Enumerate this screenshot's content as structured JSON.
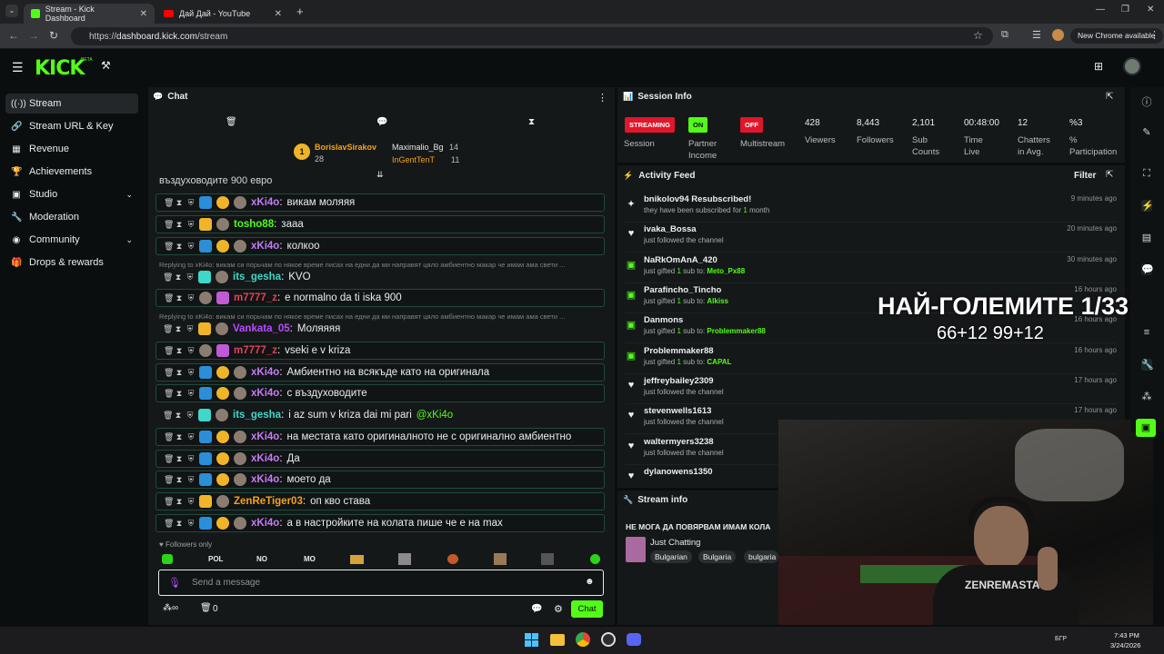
{
  "browser": {
    "tabs": [
      {
        "label": "Stream - Kick Dashboard",
        "active": true
      },
      {
        "label": "Дай Дай - YouTube",
        "active": false
      }
    ],
    "url_prefix": "https://",
    "url_host": "dashboard.kick.com",
    "url_path": "/stream",
    "new_chrome": "New Chrome available"
  },
  "sidebar": {
    "items": [
      {
        "label": "Stream",
        "icon": "broadcast-icon",
        "glyph": "((·))"
      },
      {
        "label": "Stream URL & Key",
        "icon": "link-icon",
        "glyph": "🔗"
      },
      {
        "label": "Revenue",
        "icon": "revenue-icon",
        "glyph": "▦"
      },
      {
        "label": "Achievements",
        "icon": "trophy-icon",
        "glyph": "🏆"
      },
      {
        "label": "Studio",
        "icon": "studio-icon",
        "glyph": "▣"
      },
      {
        "label": "Moderation",
        "icon": "wrench-icon",
        "glyph": "🔧"
      },
      {
        "label": "Community",
        "icon": "globe-icon",
        "glyph": "◉"
      },
      {
        "label": "Drops & rewards",
        "icon": "gift-icon",
        "glyph": "🎁"
      }
    ]
  },
  "chat": {
    "title": "Chat",
    "pinned": [
      {
        "rank": "1",
        "name": "BorislavSirakov",
        "count": "28"
      },
      {
        "name": "Maximalio_Bg",
        "count": "14"
      },
      {
        "name": "InGentTenT",
        "count": "11"
      }
    ],
    "pinned_partial": "въздуховодите 900 евро",
    "messages": [
      {
        "user": "xKi4o",
        "color": "#c57bf5",
        "text": "викам моляяя"
      },
      {
        "user": "tosho88",
        "color": "#53fc18",
        "text": "зааа"
      },
      {
        "user": "xKi4o",
        "color": "#c57bf5",
        "text": "колкоо"
      },
      {
        "reply": "Replying to xKi4o: викам си порьчам по някое време писах на едни да ми направят цяло амбиентно макар че имам ама свети ...",
        "user": "its_gesha",
        "color": "#3fd7c9",
        "text": "KVO"
      },
      {
        "user": "m7777_z",
        "color": "#e0415b",
        "text": "e normalno da ti iska 900"
      },
      {
        "reply": "Replying to xKi4o: викам си порьчам по някое време писах на едни да ми направят цяло амбиентно макар че имам ама свети ...",
        "user": "Vankata_05",
        "color": "#b54cff",
        "text": "Моляяяя"
      },
      {
        "user": "m7777_z",
        "color": "#e0415b",
        "text": "vseki e v kriza"
      },
      {
        "user": "xKi4o",
        "color": "#c57bf5",
        "text": "Амбиентно на всякъде като на оригинала"
      },
      {
        "user": "xKi4o",
        "color": "#c57bf5",
        "text": "с въздуховодите"
      },
      {
        "user": "its_gesha",
        "color": "#3fd7c9",
        "text": "i az sum v kriza dai mi pari",
        "mention": "@xKi4o"
      },
      {
        "user": "xKi4o",
        "color": "#c57bf5",
        "text": "на местата като оригиналното не с оригинално амбиентно"
      },
      {
        "user": "xKi4o",
        "color": "#c57bf5",
        "text": "Да"
      },
      {
        "user": "xKi4o",
        "color": "#c57bf5",
        "text": "моето да"
      },
      {
        "user": "ZenReTiger03",
        "color": "#f4a21a",
        "text": "оп кво става"
      },
      {
        "user": "xKi4o",
        "color": "#c57bf5",
        "text": "а в настройките на колата пише че е на max"
      }
    ],
    "followers_only": "Followers only",
    "emote_labels": [
      "POL",
      "NO",
      "MO"
    ],
    "input_placeholder": "Send a message",
    "count": "0",
    "send_label": "Chat"
  },
  "session": {
    "title": "Session Info",
    "pills": [
      {
        "label": "STREAMING",
        "bg": "#e0162b"
      },
      {
        "label": "ON",
        "bg": "#53fc18"
      },
      {
        "label": "OFF",
        "bg": "#e0162b"
      }
    ],
    "pill_captions": [
      "Session",
      "Partner\nIncome",
      "Multistream"
    ],
    "stats": [
      {
        "value": "428",
        "label": "Viewers"
      },
      {
        "value": "8,443",
        "label": "Followers"
      },
      {
        "value": "2,101",
        "label": "Sub\nCounts"
      },
      {
        "value": "00:48:00",
        "label": "Time\nLive"
      },
      {
        "value": "12",
        "label": "Chatters\nin Avg."
      },
      {
        "value": "%3",
        "label": "%\nParticipation"
      }
    ]
  },
  "activity": {
    "title": "Activity Feed",
    "filter": "Filter",
    "items": [
      {
        "icon": "sparkle-icon",
        "glyph": "✦",
        "name": "bnikolov94 Resubscribed!",
        "sub_pre": "they have been subscribed for ",
        "sub_hl": "1",
        "sub_post": " month",
        "time": "9 minutes ago"
      },
      {
        "icon": "heart-icon",
        "glyph": "♥",
        "name": "ivaka_Bossa",
        "sub_pre": "just followed the channel",
        "sub_hl": "",
        "sub_post": "",
        "time": "20 minutes ago"
      },
      {
        "icon": "gift-icon",
        "glyph": "▣",
        "name": "NaRkOmAnA_420",
        "sub_pre": "just gifted ",
        "sub_hl": "1",
        "sub_post": " sub to: ",
        "target": "Meto_Px88",
        "time": "30 minutes ago"
      },
      {
        "icon": "gift-icon",
        "glyph": "▣",
        "name": "Parafincho_Tincho",
        "sub_pre": "just gifted ",
        "sub_hl": "1",
        "sub_post": " sub to: ",
        "target": "Alkiss",
        "time": "16 hours ago"
      },
      {
        "icon": "gift-icon",
        "glyph": "▣",
        "name": "Danmons",
        "sub_pre": "just gifted ",
        "sub_hl": "1",
        "sub_post": " sub to: ",
        "target": "Problemmaker88",
        "time": "16 hours ago"
      },
      {
        "icon": "gift-icon",
        "glyph": "▣",
        "name": "Problemmaker88",
        "sub_pre": "just gifted ",
        "sub_hl": "1",
        "sub_post": " sub to: ",
        "target": "CAPAL",
        "time": "16 hours ago"
      },
      {
        "icon": "heart-icon",
        "glyph": "♥",
        "name": "jeffreybailey2309",
        "sub_pre": "just followed the channel",
        "sub_hl": "",
        "sub_post": "",
        "time": "17 hours ago"
      },
      {
        "icon": "heart-icon",
        "glyph": "♥",
        "name": "stevenwells1613",
        "sub_pre": "just followed the channel",
        "sub_hl": "",
        "sub_post": "",
        "time": "17 hours ago"
      },
      {
        "icon": "heart-icon",
        "glyph": "♥",
        "name": "waltermyers3238",
        "sub_pre": "just followed the channel",
        "sub_hl": "",
        "sub_post": "",
        "time": ""
      },
      {
        "icon": "heart-icon",
        "glyph": "♥",
        "name": "dylanowens1350",
        "sub_pre": "",
        "sub_hl": "",
        "sub_post": "",
        "time": ""
      }
    ]
  },
  "stream_info": {
    "title": "Stream info",
    "stream_title": "НЕ МОГА ДА ПОВЯРВАМ ИМАМ КОЛА",
    "category": "Just Chatting",
    "tags": [
      "Bulgarian",
      "Bulgaria",
      "bulgaria"
    ]
  },
  "overlay": {
    "headline": "НАЙ-ГОЛЕМИТЕ 1/33",
    "subline": "66+12 99+12"
  },
  "taskbar": {
    "lang": "БГР",
    "time": "7:43 PM",
    "date": "3/24/2026"
  }
}
